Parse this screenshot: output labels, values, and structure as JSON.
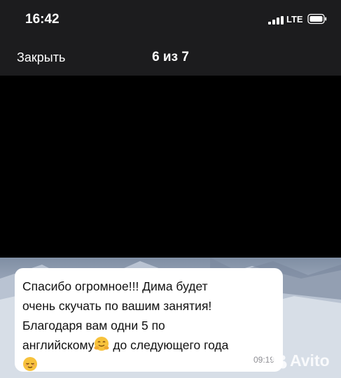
{
  "status_bar": {
    "time": "16:42",
    "network": "LTE"
  },
  "nav": {
    "close_label": "Закрыть",
    "counter": "6 из 7"
  },
  "message": {
    "line1": "Спасибо огромное!!! Дима будет",
    "line2": "очень скучать по вашим занятия!",
    "line3": "Благодаря вам одни 5 по",
    "line4a": "английскому",
    "line4b": " до следующего года",
    "time": "09:19"
  },
  "watermark": {
    "text": "Avito"
  },
  "icons": {
    "signal": "signal-bars-icon",
    "battery": "battery-icon",
    "hug_emoji": "hugging-face-emoji",
    "relieved_emoji": "relieved-face-emoji",
    "watermark_logo": "avito-dots-icon"
  }
}
